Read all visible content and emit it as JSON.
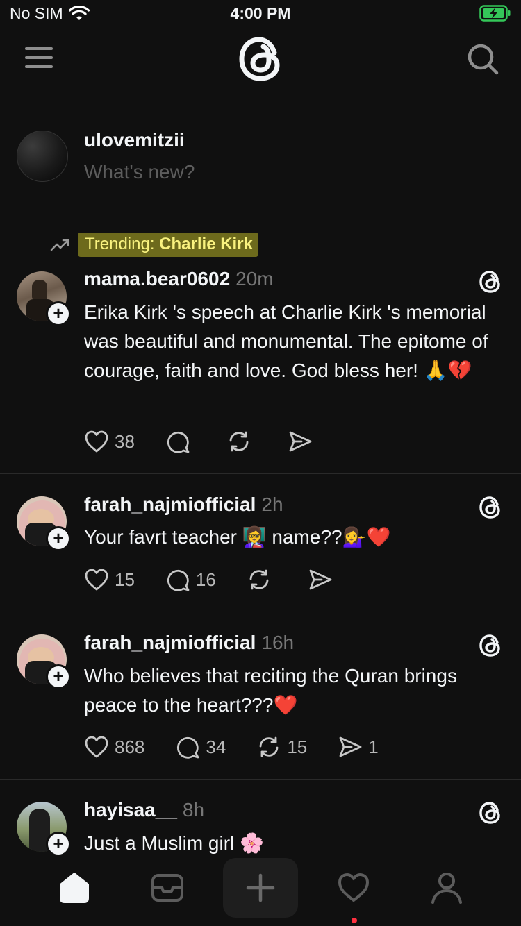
{
  "status_bar": {
    "carrier": "No SIM",
    "time": "4:00 PM"
  },
  "composer": {
    "username": "ulovemitzii",
    "placeholder": "What's new?"
  },
  "trending": {
    "prefix": "Trending: ",
    "topic": "Charlie Kirk"
  },
  "posts": [
    {
      "username": "mama.bear0602",
      "time": "20m",
      "text": "Erika Kirk 's speech at Charlie Kirk 's memorial was beautiful and monumental. The epitome of courage, faith and love. God bless her! 🙏💔",
      "likes": "38",
      "replies": "",
      "reposts": "",
      "shares": ""
    },
    {
      "username": "farah_najmiofficial",
      "time": "2h",
      "text": "Your favrt teacher 👩‍🏫 name??💁‍♀️❤️",
      "likes": "15",
      "replies": "16",
      "reposts": "",
      "shares": ""
    },
    {
      "username": "farah_najmiofficial",
      "time": "16h",
      "text": "Who believes that reciting the Quran brings peace to the heart???❤️",
      "likes": "868",
      "replies": "34",
      "reposts": "15",
      "shares": "1"
    },
    {
      "username": "hayisaa__",
      "time": "8h",
      "text": "Just a Muslim girl 🌸",
      "likes": "",
      "replies": "",
      "reposts": "",
      "shares": ""
    }
  ],
  "colors": {
    "background": "#101010",
    "text": "#f3f5f7",
    "muted": "#777777",
    "trend_highlight": "#6d6a1c",
    "notification_dot": "#ff3040",
    "battery": "#34c759"
  },
  "tabbar": {
    "items": [
      "home-icon",
      "inbox-icon",
      "compose-icon",
      "activity-icon",
      "profile-icon"
    ]
  }
}
